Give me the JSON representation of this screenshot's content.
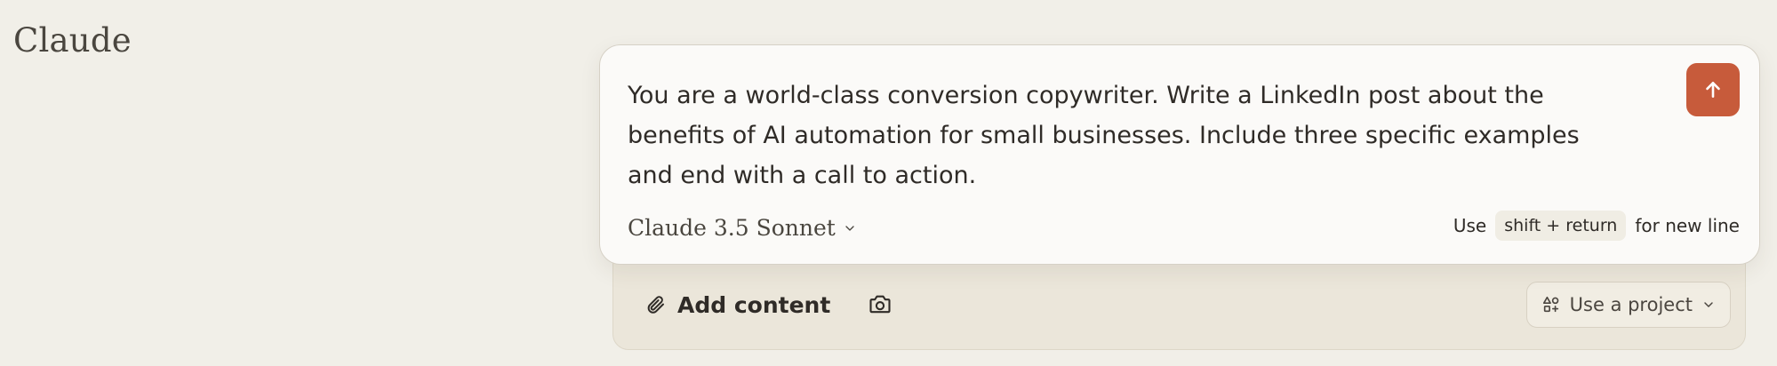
{
  "app": {
    "title": "Claude"
  },
  "composer": {
    "prompt_text": "You are a world-class conversion copywriter. Write a LinkedIn post about the benefits of AI automation for small businesses. Include three specific examples and end with a call to action.",
    "model": {
      "label": "Claude 3.5 Sonnet",
      "icon": "chevron-down-icon"
    },
    "hint": {
      "prefix": "Use",
      "shortcut": "shift + return",
      "suffix": "for new line"
    },
    "send_button": {
      "icon": "arrow-up-icon",
      "color": "#c75b3b"
    }
  },
  "tray": {
    "add_content": {
      "label": "Add content",
      "icon": "paperclip-icon"
    },
    "camera": {
      "icon": "camera-icon"
    },
    "project_select": {
      "label": "Use a project",
      "icon": "project-shapes-icon"
    }
  },
  "theme": {
    "page_background": "#f1efe8",
    "composer_background": "#fbfaf8",
    "tray_background": "#ebe6da",
    "accent": "#c75b3b"
  }
}
